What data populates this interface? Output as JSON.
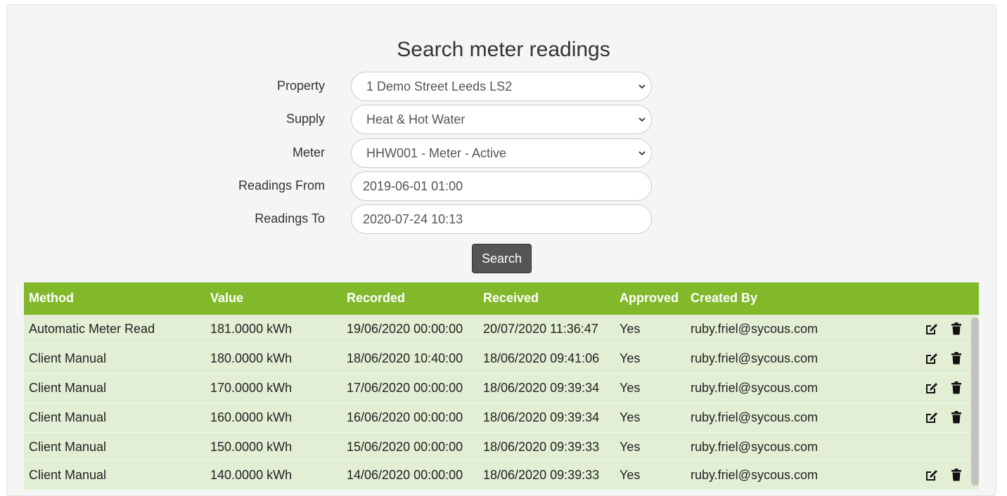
{
  "page": {
    "title": "Search meter readings",
    "search_button": "Search"
  },
  "form": {
    "property": {
      "label": "Property",
      "value": "1 Demo Street Leeds LS2"
    },
    "supply": {
      "label": "Supply",
      "value": "Heat & Hot Water"
    },
    "meter": {
      "label": "Meter",
      "value": "HHW001 - Meter - Active"
    },
    "readings_from": {
      "label": "Readings From",
      "value": "2019-06-01 01:00"
    },
    "readings_to": {
      "label": "Readings To",
      "value": "2020-07-24 10:13"
    }
  },
  "table": {
    "header_color": "#82b92a",
    "row_color": "#e2efd4",
    "columns": [
      "Method",
      "Value",
      "Recorded",
      "Received",
      "Approved",
      "Created By"
    ],
    "rows": [
      {
        "method": "Automatic Meter Read",
        "value": "181.0000 kWh",
        "recorded": "19/06/2020 00:00:00",
        "received": "20/07/2020 11:36:47",
        "approved": "Yes",
        "created_by": "ruby.friel@sycous.com",
        "actions": true
      },
      {
        "method": "Client Manual",
        "value": "180.0000 kWh",
        "recorded": "18/06/2020 10:40:00",
        "received": "18/06/2020 09:41:06",
        "approved": "Yes",
        "created_by": "ruby.friel@sycous.com",
        "actions": true
      },
      {
        "method": "Client Manual",
        "value": "170.0000 kWh",
        "recorded": "17/06/2020 00:00:00",
        "received": "18/06/2020 09:39:34",
        "approved": "Yes",
        "created_by": "ruby.friel@sycous.com",
        "actions": true
      },
      {
        "method": "Client Manual",
        "value": "160.0000 kWh",
        "recorded": "16/06/2020 00:00:00",
        "received": "18/06/2020 09:39:34",
        "approved": "Yes",
        "created_by": "ruby.friel@sycous.com",
        "actions": true
      },
      {
        "method": "Client Manual",
        "value": "150.0000 kWh",
        "recorded": "15/06/2020 00:00:00",
        "received": "18/06/2020 09:39:33",
        "approved": "Yes",
        "created_by": "ruby.friel@sycous.com",
        "actions": false
      },
      {
        "method": "Client Manual",
        "value": "140.0000 kWh",
        "recorded": "14/06/2020 00:00:00",
        "received": "18/06/2020 09:39:33",
        "approved": "Yes",
        "created_by": "ruby.friel@sycous.com",
        "actions": true
      }
    ],
    "action_icons": [
      "edit-icon",
      "trash-icon"
    ]
  }
}
